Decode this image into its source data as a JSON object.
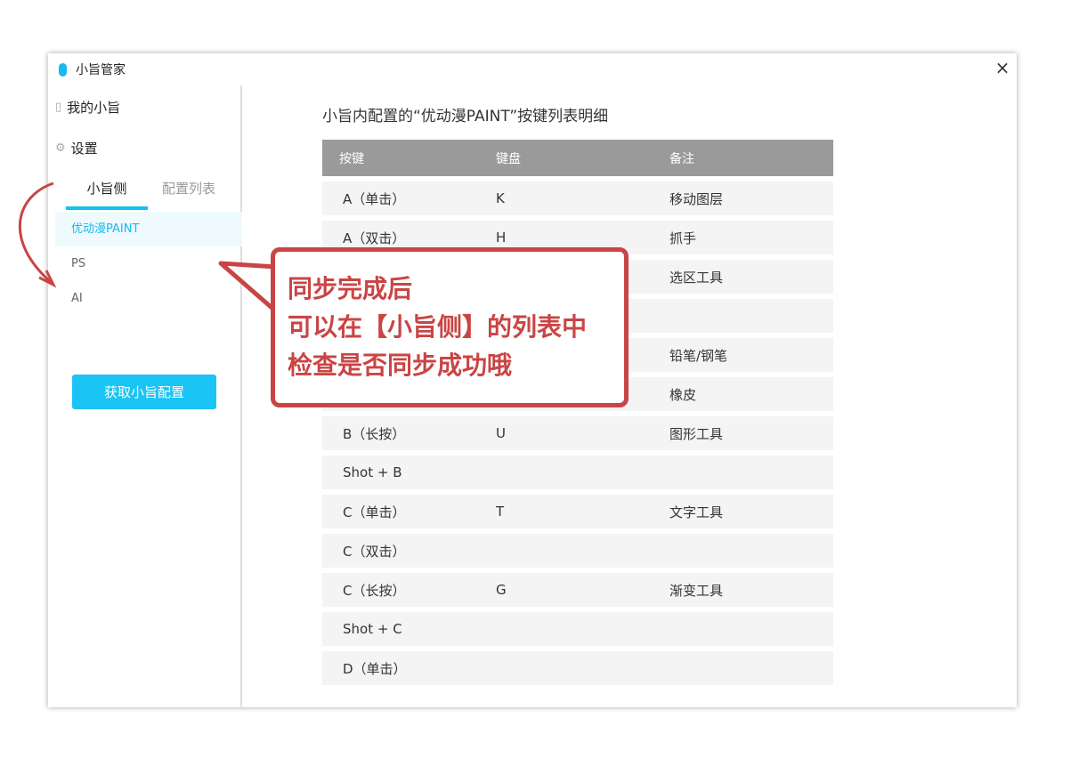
{
  "window": {
    "title": "小旨管家",
    "close": "×"
  },
  "sidebar": {
    "nav": [
      {
        "label": "我的小旨",
        "icon": "device-icon"
      },
      {
        "label": "设置",
        "icon": "gear-icon"
      }
    ],
    "tabs": [
      {
        "label": "小旨侧"
      },
      {
        "label": "配置列表"
      }
    ],
    "items": [
      {
        "label": "优动漫PAINT"
      },
      {
        "label": "PS"
      },
      {
        "label": "AI"
      }
    ],
    "button": "获取小旨配置"
  },
  "main": {
    "heading": "小旨内配置的“优动漫PAINT”按键列表明细",
    "columns": [
      "按键",
      "键盘",
      "备注"
    ],
    "rows": [
      [
        "A（单击）",
        "K",
        "移动图层"
      ],
      [
        "A（双击）",
        "H",
        "抓手"
      ],
      [
        "",
        "",
        "选区工具"
      ],
      [
        "",
        "",
        ""
      ],
      [
        "",
        "",
        "铅笔/钢笔"
      ],
      [
        "",
        "",
        "橡皮"
      ],
      [
        "B（长按）",
        "U",
        "图形工具"
      ],
      [
        "Shot + B",
        "",
        ""
      ],
      [
        "C（单击）",
        "T",
        "文字工具"
      ],
      [
        "C（双击）",
        "",
        ""
      ],
      [
        "C（长按）",
        "G",
        "渐变工具"
      ],
      [
        "Shot + C",
        "",
        ""
      ],
      [
        "D（单击）",
        "",
        ""
      ]
    ]
  },
  "callout": {
    "lines": [
      "同步完成后",
      "可以在【小旨侧】的列表中",
      "检查是否同步成功哦"
    ]
  },
  "colors": {
    "accent": "#1ac4f4",
    "callout": "#c94545"
  }
}
